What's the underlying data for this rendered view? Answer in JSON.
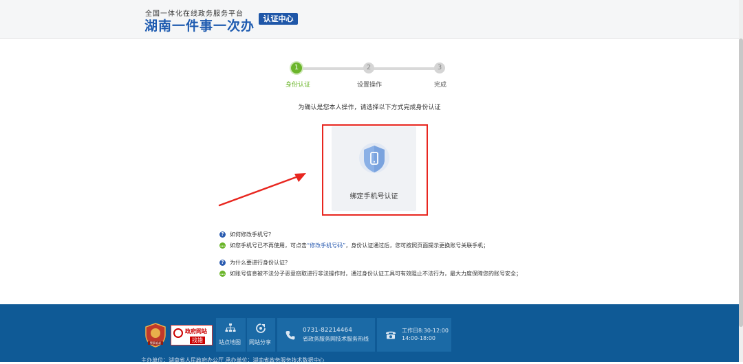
{
  "header": {
    "platform_subtitle": "全国一体化在线政务服务平台",
    "platform_title": "湖南一件事一次办",
    "section_badge": "认证中心"
  },
  "steps": [
    {
      "number": "1",
      "label": "身份认证",
      "active": true
    },
    {
      "number": "2",
      "label": "设置操作",
      "active": false
    },
    {
      "number": "3",
      "label": "完成",
      "active": false
    }
  ],
  "instruction": "为确认是您本人操作，请选择以下方式完成身份认证",
  "auth_option": {
    "label": "绑定手机号认证",
    "icon": "phone-shield-icon"
  },
  "faq": [
    {
      "question": "如何修改手机号？",
      "answer_before": "如您手机号已不再使用，可点击",
      "answer_link": "“修改手机号码”",
      "answer_after": "，身份认证通过后，您可按照页面提示更换账号关联手机；"
    },
    {
      "question": "为什么要进行身份认证？",
      "answer": "如账号信息被不法分子恶意窃取进行非法操作时，通过身份认证工具可有效阻止不法行为，最大力度保障您的账号安全；"
    }
  ],
  "footer": {
    "police_badge_text": "警察叔叔",
    "gov_badge_title": "政府网站",
    "gov_badge_sub": "找错",
    "sitemap_label": "站点地图",
    "share_label": "网站分享",
    "hotline_number": "0731-82214464",
    "hotline_desc": "省政务服务网技术服务热线",
    "hours_title": "工作日8:30-12:00",
    "hours_afternoon": "14:00-18:00",
    "bottom_text": "主办单位：湖南省人民政府办公厅    承办单位：湖南省政务服务技术数据中心"
  },
  "colors": {
    "brand_blue": "#1e5bb0",
    "step_active": "#6bb52a",
    "highlight_red": "#e8261f",
    "footer_bg": "#0f5a96"
  }
}
